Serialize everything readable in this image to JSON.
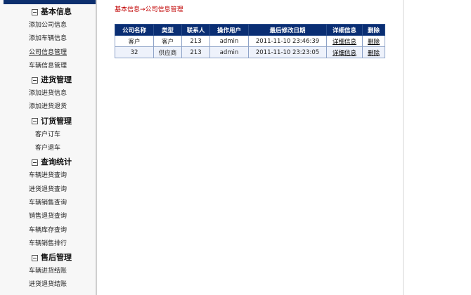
{
  "breadcrumb": "基本信息→公司信息管理",
  "sidebar": {
    "groups": [
      {
        "title": "基本信息",
        "items": [
          "添加公司信息",
          "添加车辆信息",
          "公司信息管理",
          "车辆信息管理"
        ]
      },
      {
        "title": "进货管理",
        "items": [
          "添加进货信息",
          "添加进货退货"
        ]
      },
      {
        "title": "订货管理",
        "items": [
          "客户订车",
          "客户退车"
        ]
      },
      {
        "title": "查询统计",
        "items": [
          "车辆进货查询",
          "进货退货查询",
          "车辆销售查询",
          "销售退货查询",
          "车辆库存查询",
          "车辆销售排行"
        ]
      },
      {
        "title": "售后管理",
        "items": [
          "车辆进货结账",
          "进货退货结账"
        ]
      }
    ]
  },
  "table": {
    "headers": [
      "公司名称",
      "类型",
      "联系人",
      "操作用户",
      "最后修改日期",
      "详细信息",
      "删除"
    ],
    "rows": [
      [
        "客户",
        "客户",
        "213",
        "admin",
        "2011-11-10 23:46:39",
        "详细信息",
        "删除"
      ],
      [
        "32",
        "供应商",
        "213",
        "admin",
        "2011-11-10 23:23:05",
        "详细信息",
        "删除"
      ]
    ]
  },
  "colors": {
    "header_bg": "#0a2e73",
    "breadcrumb": "#c00000",
    "sidebar_bg": "#f7f7f7"
  }
}
